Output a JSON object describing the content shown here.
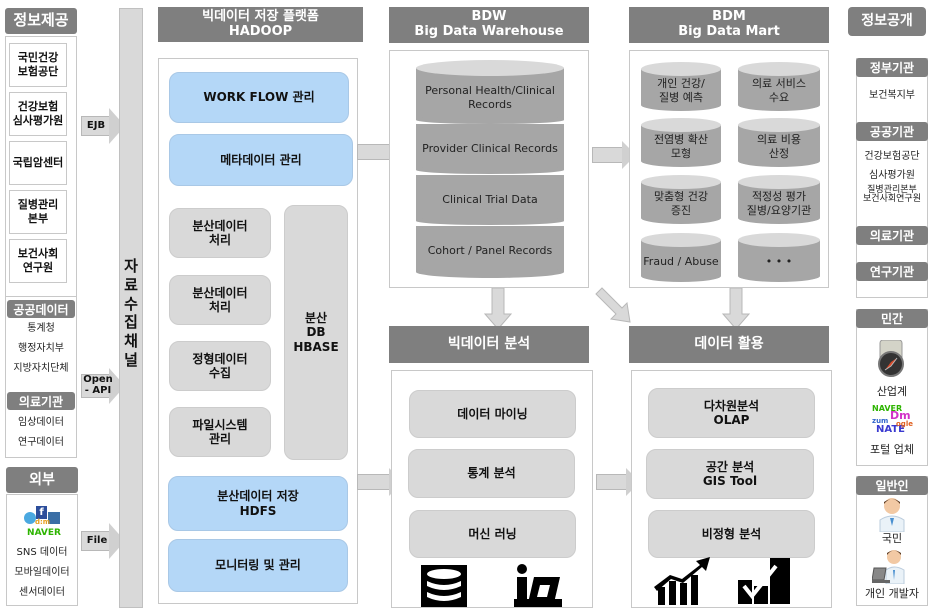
{
  "left_column": {
    "info_provision": {
      "title": "정보제공",
      "institutions": [
        {
          "line1": "국민건강",
          "line2": "보험공단"
        },
        {
          "line1": "건강보험",
          "line2": "심사평가원"
        },
        {
          "line1": "국립암센터",
          "line2": ""
        },
        {
          "line1": "질병관리",
          "line2": "본부"
        },
        {
          "line1": "보건사회",
          "line2": "연구원"
        }
      ]
    },
    "public_data": {
      "title": "공공데이터",
      "items": [
        "통계청",
        "행정자치부",
        "지방자치단체"
      ]
    },
    "medical_institutions": {
      "title": "의료기관",
      "items": [
        "임상데이터",
        "연구데이터"
      ]
    },
    "external": {
      "title": "외부",
      "logo_label": "NAVER",
      "items": [
        "SNS 데이터",
        "모바일데이터",
        "센서데이터"
      ]
    }
  },
  "arrows": {
    "ejb": "EJB",
    "open_api_line1": "Open",
    "open_api_line2": "- API",
    "file": "File"
  },
  "collection_channel": {
    "chars": [
      "자",
      "료",
      "수",
      "집",
      "채",
      "널"
    ]
  },
  "hadoop": {
    "title_line1": "빅데이터 저장 플랫폼",
    "title_line2": "HADOOP",
    "workflow": "WORK FLOW 관리",
    "metadata": "메타데이터 관리",
    "distributed_processing_1": {
      "line1": "분산데이터",
      "line2": "처리"
    },
    "distributed_processing_2": {
      "line1": "분산데이터",
      "line2": "처리"
    },
    "structured_collection": {
      "line1": "정형데이터",
      "line2": "수집"
    },
    "filesystem": {
      "line1": "파일시스템",
      "line2": "관리"
    },
    "hbase": {
      "line1": "분산",
      "line2": "DB",
      "line3": "HBASE"
    },
    "hdfs": {
      "line1": "분산데이터 저장",
      "line2": "HDFS"
    },
    "monitoring": "모니터링 및 관리"
  },
  "bdw": {
    "title_line1": "BDW",
    "title_line2": "Big Data Warehouse",
    "layers": [
      {
        "line1": "Personal Health/Clinical",
        "line2": "Records"
      },
      {
        "line1": "Provider Clinical Records",
        "line2": ""
      },
      {
        "line1": "Clinical Trial Data",
        "line2": ""
      },
      {
        "line1": "Cohort / Panel Records",
        "line2": ""
      }
    ]
  },
  "bdm": {
    "title_line1": "BDM",
    "title_line2": "Big Data Mart",
    "marts": [
      {
        "line1": "개인 건강/",
        "line2": "질병 예측"
      },
      {
        "line1": "의료 서비스",
        "line2": "수요"
      },
      {
        "line1": "전염병 확산",
        "line2": "모형"
      },
      {
        "line1": "의료 비용",
        "line2": "산정"
      },
      {
        "line1": "맞춤형 건강",
        "line2": "증진"
      },
      {
        "line1": "적정성 평가",
        "line2": "질병/요양기관"
      },
      {
        "line1": "Fraud / Abuse",
        "line2": ""
      },
      {
        "line1": "• • •",
        "line2": ""
      }
    ]
  },
  "analysis": {
    "title": "빅데이터 분석",
    "items": [
      "데이터 마이닝",
      "통계 분석",
      "머신 러닝"
    ]
  },
  "utilization": {
    "title": "데이터 활용",
    "items": [
      {
        "line1": "다차원분석",
        "line2": "OLAP"
      },
      {
        "line1": "공간 분석",
        "line2": "GIS Tool"
      },
      {
        "line1": "비정형 분석",
        "line2": ""
      }
    ]
  },
  "right_column": {
    "title": "정보공개",
    "government": {
      "title": "정부기관",
      "items": [
        "보건복지부"
      ]
    },
    "public": {
      "title": "공공기관",
      "items": [
        "건강보험공단",
        "심사평가원",
        "질병관리본부",
        "보건사회연구원"
      ]
    },
    "medical": {
      "title": "의료기관"
    },
    "research": {
      "title": "연구기관"
    },
    "private": {
      "title": "민간",
      "items": [
        "산업계",
        "포털 업체"
      ],
      "portal_logo_text": "NAVER"
    },
    "general": {
      "title": "일반인",
      "items": [
        "국민",
        "개인 개발자"
      ]
    }
  },
  "colors": {
    "header_gray": "#7f7f7f",
    "box_blue": "#b4d7f7",
    "box_gray": "#d9d9d9",
    "cylinder_body": "#a6a6a6",
    "cylinder_top": "#d9d9d9"
  }
}
